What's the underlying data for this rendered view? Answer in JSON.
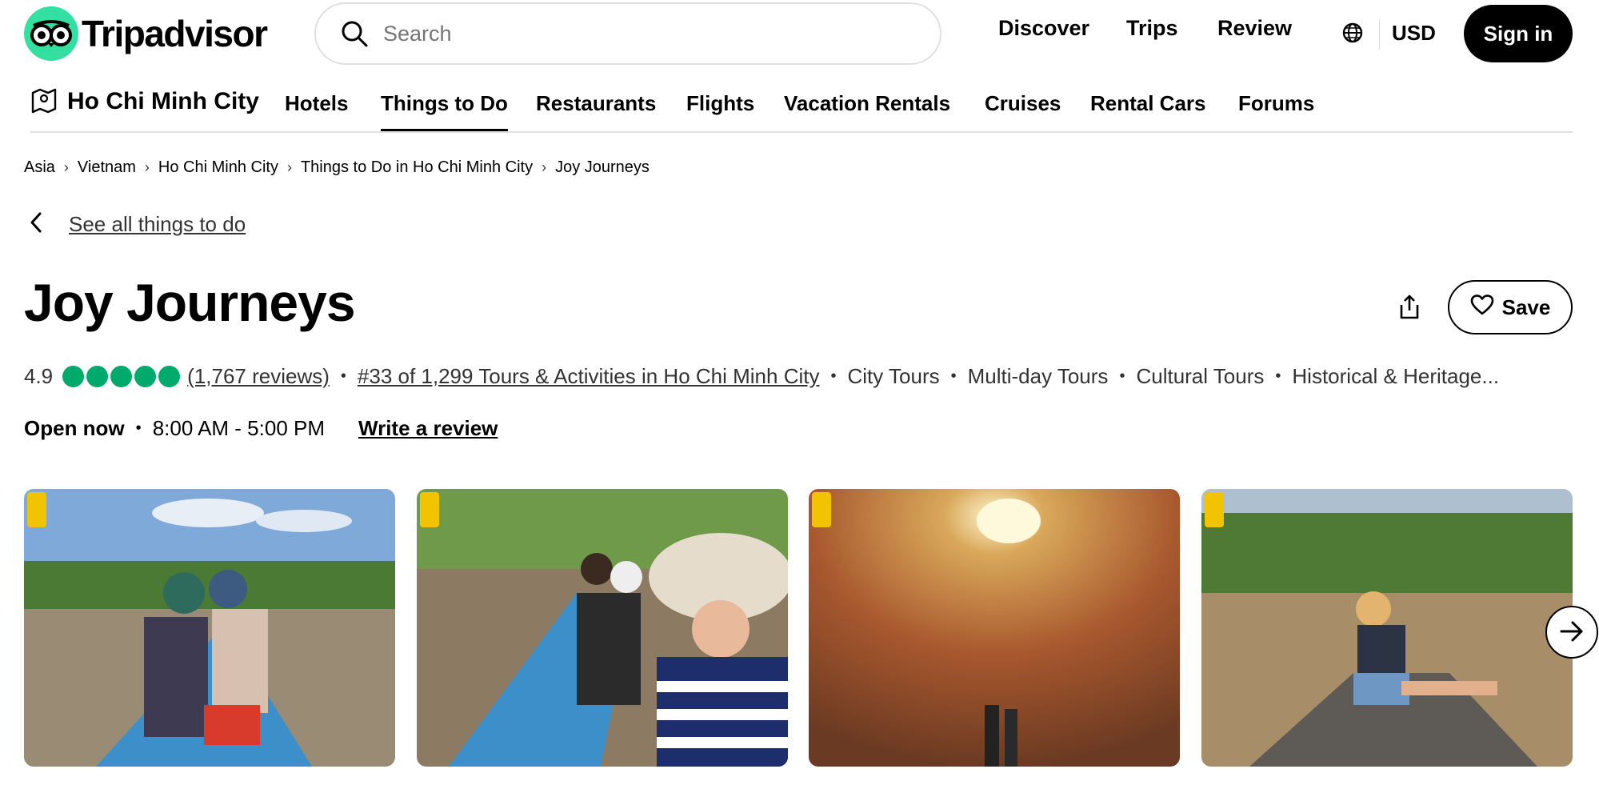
{
  "header": {
    "logo_text": "Tripadvisor",
    "search_placeholder": "Search",
    "nav": [
      "Discover",
      "Trips",
      "Review"
    ],
    "currency": "USD",
    "sign_in": "Sign in",
    "brand_color": "#34e0a1"
  },
  "subnav": {
    "city": "Ho Chi Minh City",
    "items": [
      "Hotels",
      "Things to Do",
      "Restaurants",
      "Flights",
      "Vacation Rentals",
      "Cruises",
      "Rental Cars",
      "Forums"
    ],
    "active": "Things to Do"
  },
  "breadcrumb": [
    "Asia",
    "Vietnam",
    "Ho Chi Minh City",
    "Things to Do in Ho Chi Minh City",
    "Joy Journeys"
  ],
  "back_link": "See all things to do",
  "title": "Joy Journeys",
  "save_label": "Save",
  "rating": {
    "score": "4.9",
    "bubbles": 5,
    "bubble_color": "#00aa6c",
    "reviews": "(1,767 reviews)",
    "rank": "#33 of 1,299 Tours & Activities in Ho Chi Minh City",
    "categories": [
      "City Tours",
      "Multi-day Tours",
      "Cultural Tours",
      "Historical & Heritage..."
    ]
  },
  "hours": {
    "status": "Open now",
    "range": "8:00 AM - 5:00 PM",
    "write_review": "Write a review"
  },
  "photos": [
    "couple-in-boat-on-river",
    "group-in-boat-on-river",
    "inside-brick-kiln",
    "woman-sitting-on-boat-bow"
  ]
}
